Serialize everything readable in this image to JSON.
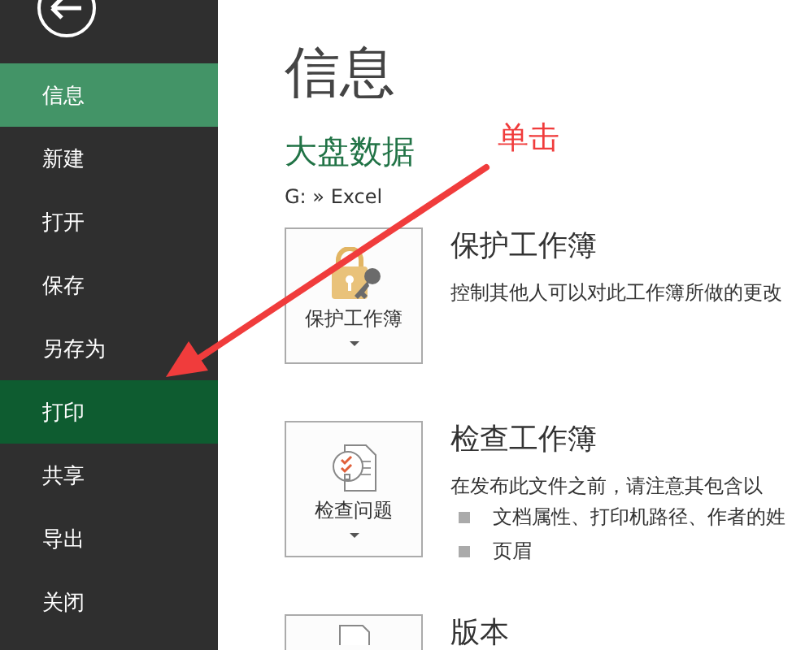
{
  "sidebar": {
    "items": [
      {
        "label": "信息",
        "selected": true,
        "hovered": false
      },
      {
        "label": "新建",
        "selected": false,
        "hovered": false
      },
      {
        "label": "打开",
        "selected": false,
        "hovered": false
      },
      {
        "label": "保存",
        "selected": false,
        "hovered": false
      },
      {
        "label": "另存为",
        "selected": false,
        "hovered": false
      },
      {
        "label": "打印",
        "selected": false,
        "hovered": true
      },
      {
        "label": "共享",
        "selected": false,
        "hovered": false
      },
      {
        "label": "导出",
        "selected": false,
        "hovered": false
      },
      {
        "label": "关闭",
        "selected": false,
        "hovered": false
      }
    ]
  },
  "title": "信息",
  "document_name": "大盘数据",
  "path": "G: » Excel",
  "sections": [
    {
      "kind": "protect",
      "button_label": "保护工作簿",
      "heading": "保护工作簿",
      "description": "控制其他人可以对此工作簿所做的更改"
    },
    {
      "kind": "inspect",
      "button_label": "检查问题",
      "heading": "检查工作簿",
      "description": "在发布此文件之前，请注意其包含以",
      "bullets": [
        "文档属性、打印机路径、作者的姓",
        "页眉"
      ]
    },
    {
      "kind": "versions",
      "heading": "版本"
    }
  ],
  "annotation": {
    "label": "单击"
  }
}
